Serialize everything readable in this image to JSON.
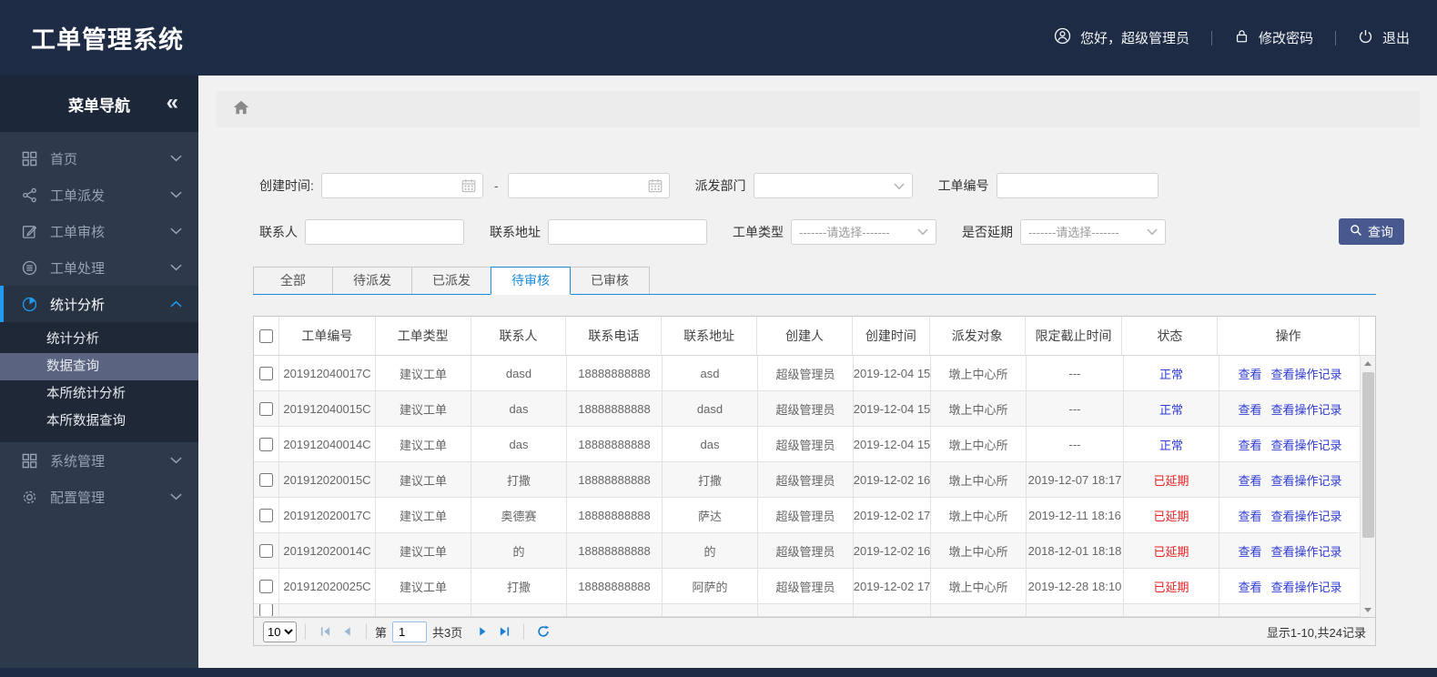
{
  "app": {
    "title": "工单管理系统"
  },
  "user_bar": {
    "greeting": "您好，超级管理员",
    "change_password": "修改密码",
    "logout": "退出"
  },
  "sidebar": {
    "title": "菜单导航",
    "collapse_icon": "«",
    "items": [
      {
        "label": "首页"
      },
      {
        "label": "工单派发"
      },
      {
        "label": "工单审核"
      },
      {
        "label": "工单处理"
      },
      {
        "label": "统计分析"
      },
      {
        "label": "系统管理"
      },
      {
        "label": "配置管理"
      }
    ],
    "submenu": [
      {
        "label": "统计分析"
      },
      {
        "label": "数据查询"
      },
      {
        "label": "本所统计分析"
      },
      {
        "label": "本所数据查询"
      }
    ]
  },
  "filters": {
    "create_time_label": "创建时间:",
    "range_separator": "-",
    "dispatch_dept_label": "派发部门",
    "order_no_label": "工单编号",
    "contact_label": "联系人",
    "address_label": "联系地址",
    "order_type_label": "工单类型",
    "delay_label": "是否延期",
    "select_placeholder": "-------请选择-------",
    "search_button": "查询"
  },
  "tabs": [
    {
      "label": "全部"
    },
    {
      "label": "待派发"
    },
    {
      "label": "已派发"
    },
    {
      "label": "待审核"
    },
    {
      "label": "已审核"
    }
  ],
  "table": {
    "columns": [
      "工单编号",
      "工单类型",
      "联系人",
      "联系电话",
      "联系地址",
      "创建人",
      "创建时间",
      "派发对象",
      "限定截止时间",
      "状态",
      "操作"
    ],
    "actions": {
      "view": "查看",
      "view_log": "查看操作记录"
    },
    "rows": [
      {
        "order_no": "201912040017C",
        "type": "建议工单",
        "contact": "dasd",
        "phone": "18888888888",
        "address": "asd",
        "creator": "超级管理员",
        "create_time": "2019-12-04 15",
        "target": "墩上中心所",
        "deadline": "---",
        "status": "正常",
        "status_type": "normal"
      },
      {
        "order_no": "201912040015C",
        "type": "建议工单",
        "contact": "das",
        "phone": "18888888888",
        "address": "dasd",
        "creator": "超级管理员",
        "create_time": "2019-12-04 15",
        "target": "墩上中心所",
        "deadline": "---",
        "status": "正常",
        "status_type": "normal"
      },
      {
        "order_no": "201912040014C",
        "type": "建议工单",
        "contact": "das",
        "phone": "18888888888",
        "address": "das",
        "creator": "超级管理员",
        "create_time": "2019-12-04 15",
        "target": "墩上中心所",
        "deadline": "---",
        "status": "正常",
        "status_type": "normal"
      },
      {
        "order_no": "201912020015C",
        "type": "建议工单",
        "contact": "打撒",
        "phone": "18888888888",
        "address": "打撒",
        "creator": "超级管理员",
        "create_time": "2019-12-02 16",
        "target": "墩上中心所",
        "deadline": "2019-12-07 18:17",
        "status": "已延期",
        "status_type": "delayed"
      },
      {
        "order_no": "201912020017C",
        "type": "建议工单",
        "contact": "奥德赛",
        "phone": "18888888888",
        "address": "萨达",
        "creator": "超级管理员",
        "create_time": "2019-12-02 17",
        "target": "墩上中心所",
        "deadline": "2019-12-11 18:16",
        "status": "已延期",
        "status_type": "delayed"
      },
      {
        "order_no": "201912020014C",
        "type": "建议工单",
        "contact": "的",
        "phone": "18888888888",
        "address": "的",
        "creator": "超级管理员",
        "create_time": "2019-12-02 16",
        "target": "墩上中心所",
        "deadline": "2018-12-01 18:18",
        "status": "已延期",
        "status_type": "delayed"
      },
      {
        "order_no": "201912020025C",
        "type": "建议工单",
        "contact": "打撒",
        "phone": "18888888888",
        "address": "阿萨的",
        "creator": "超级管理员",
        "create_time": "2019-12-02 17",
        "target": "墩上中心所",
        "deadline": "2019-12-28 18:10",
        "status": "已延期",
        "status_type": "delayed"
      }
    ]
  },
  "pagination": {
    "page_size": "10",
    "page_prefix": "第",
    "current_page": "1",
    "total_pages": "共3页",
    "summary": "显示1-10,共24记录"
  },
  "colors": {
    "header_bg": "#1e2b45",
    "sidebar_bg": "#2d3a4c",
    "accent_blue": "#1f9bf0",
    "tab_blue": "#1a8bd8",
    "link_blue": "#2f3bd3",
    "status_normal": "#2f3bd3",
    "status_delayed": "#e62222",
    "search_button_bg": "#47598f"
  }
}
